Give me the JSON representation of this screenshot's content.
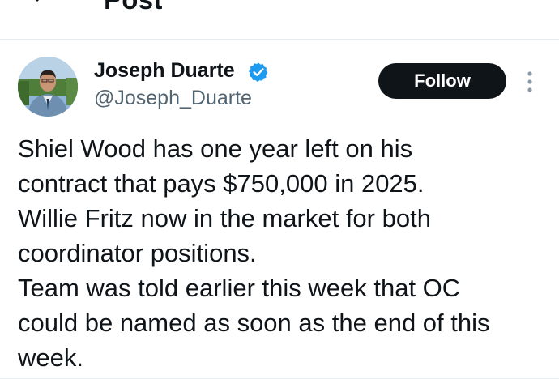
{
  "header": {
    "title": "Post",
    "back_icon": "arrow-left-icon"
  },
  "author": {
    "name": "Joseph Duarte",
    "handle": "@Joseph_Duarte",
    "verified_icon": "verified-badge-icon",
    "verified_color": "#1d9bf0"
  },
  "actions": {
    "follow_label": "Follow",
    "more_icon": "more-vertical-icon"
  },
  "post": {
    "lines": [
      "Shiel Wood has one year left on his",
      "contract that pays $750,000 in 2025.",
      "Willie Fritz now in the market for both",
      "coordinator positions.",
      "Team was told earlier this week that OC",
      "could be named as soon as the end of this",
      "week."
    ]
  },
  "colors": {
    "text": "#0f1419",
    "secondary_text": "#536471",
    "button_bg": "#0f1419",
    "button_text": "#ffffff",
    "accent": "#1d9bf0"
  }
}
